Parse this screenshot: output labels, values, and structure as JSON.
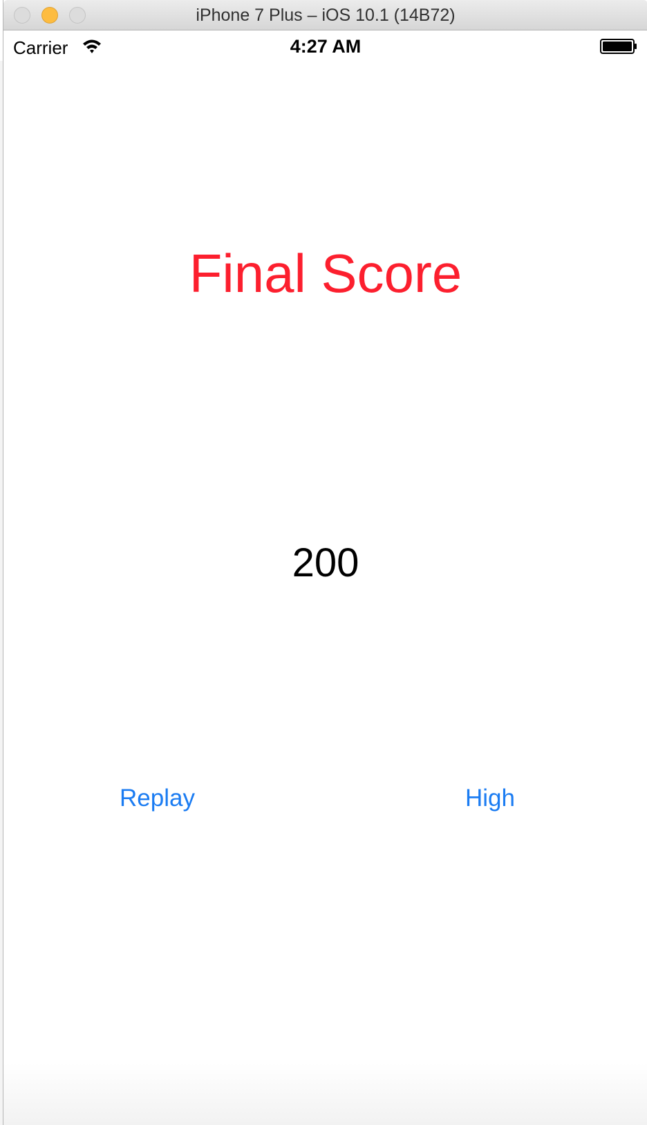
{
  "window": {
    "title": "iPhone 7 Plus – iOS 10.1 (14B72)"
  },
  "status_bar": {
    "carrier": "Carrier",
    "time": "4:27 AM",
    "icons": [
      "wifi-icon",
      "battery-icon"
    ]
  },
  "game_over": {
    "title": "Final Score",
    "score": "200",
    "replay_label": "Replay",
    "high_label": "High"
  },
  "colors": {
    "title": "#fc1f2e",
    "button_tint": "#1b7cf2",
    "score": "#000000"
  }
}
